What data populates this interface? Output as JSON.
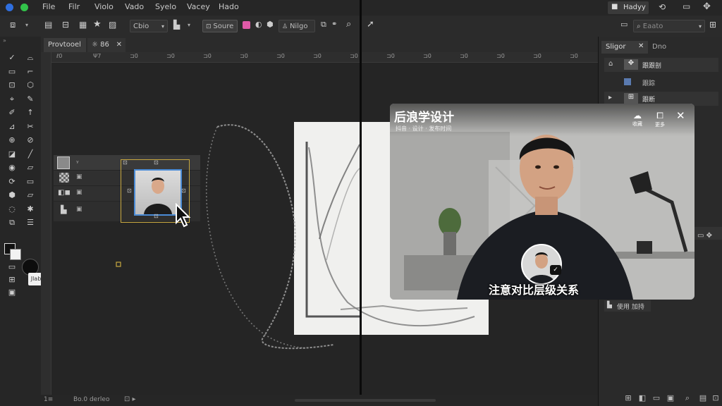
{
  "menubar": {
    "items": [
      "File",
      "Filr",
      "Violo",
      "Vado",
      "Syelo",
      "Vacey",
      "Hado"
    ],
    "right_label": "Hadyy"
  },
  "options": {
    "dropdown": "Cbio",
    "source_btn": "Soure",
    "mode_btn": "Nilgo",
    "search_placeholder": "Eaato"
  },
  "tabs": {
    "doc1": "Provtooel",
    "doc2": "☼ 86"
  },
  "ruler_top": [
    "ℓ0",
    "Ψ7",
    "⊐0",
    "⊐0",
    "⊐0",
    "⊐0",
    "⊐0",
    "⊐0",
    "⊐0",
    "⊐0",
    "⊐0",
    "⊐0",
    "⊐0",
    "⊐0",
    "⊐0"
  ],
  "tool_swatch_label": "Jlab",
  "status": {
    "zoom": "Bo.0 derleo"
  },
  "right_panel": {
    "tab1": "Sligor",
    "tab2": "Dno",
    "row1": "跟跟剖",
    "row2": "跟踪",
    "row3": "跟断",
    "bottom_btn": "使用 加持"
  },
  "video": {
    "title": "后浪学设计",
    "subtitle": "抖音 · 设计 · 发布时间",
    "caption": "注意对比层级关系",
    "btn1_label": "收藏",
    "btn2_label": "更多"
  },
  "colors": {
    "accent": "#4a8bd6",
    "selection": "#d6b94a",
    "pink": "#e05aa8"
  }
}
